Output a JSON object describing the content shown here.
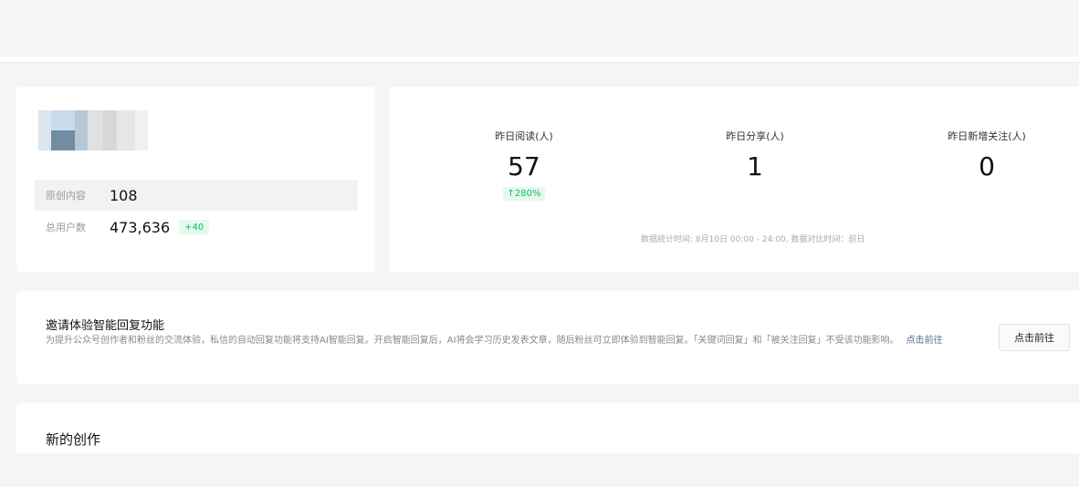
{
  "account": {
    "avatar_colors": [
      "#c9dbe9",
      "#6f8ea3",
      "#b7c7d3",
      "#e0e0e0",
      "#d7d7d7",
      "#e6e6e6",
      "#f0f0f0"
    ],
    "stats": [
      {
        "label": "原创内容",
        "value": "108",
        "badge": ""
      },
      {
        "label": "总用户数",
        "value": "473,636",
        "badge": "+40"
      }
    ]
  },
  "yesterday": {
    "metrics": [
      {
        "label": "昨日阅读(人)",
        "value": "57",
        "change": "↑280%"
      },
      {
        "label": "昨日分享(人)",
        "value": "1",
        "change": ""
      },
      {
        "label": "昨日新增关注(人)",
        "value": "0",
        "change": ""
      }
    ],
    "footnote": "数据统计时间: 8月10日 00:00 - 24:00, 数据对比时间：前日"
  },
  "invite": {
    "title": "邀请体验智能回复功能",
    "description": "为提升公众号创作者和粉丝的交流体验，私信的自动回复功能将支持AI智能回复。开启智能回复后，AI将会学习历史发表文章，随后粉丝可立即体验到智能回复。「关键词回复」和「被关注回复」不受该功能影响。",
    "link_label": "点击前往",
    "button_label": "点击前往"
  },
  "creation": {
    "title": "新的创作"
  },
  "colors": {
    "accent_green": "#07c160",
    "link_blue": "#576b95",
    "background": "#f5f5f5"
  }
}
